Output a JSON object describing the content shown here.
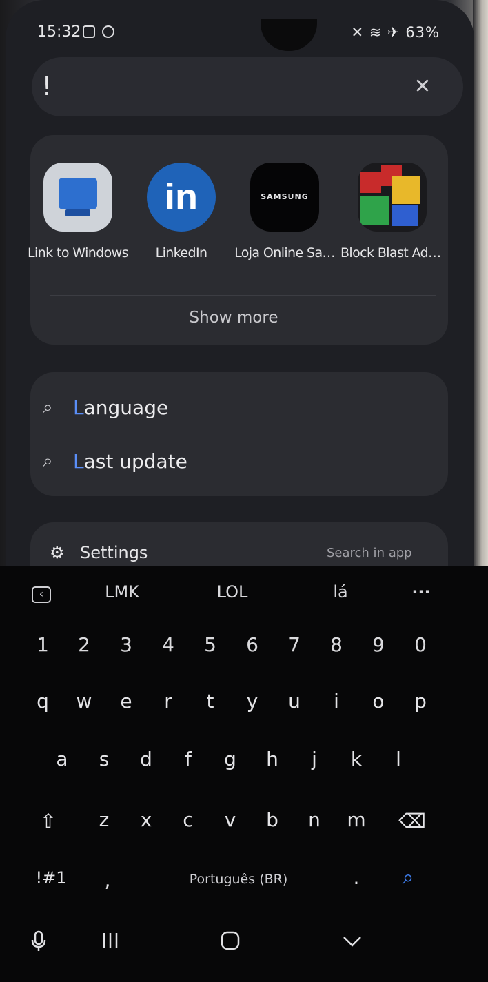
{
  "status_bar": {
    "time": "15:32",
    "right_icons": "✕ ≋ ✈ 63%"
  },
  "search": {
    "query": "!",
    "clear_icon": "✕"
  },
  "apps": [
    {
      "label": "Link to Windows",
      "icon": "link-to-windows-icon"
    },
    {
      "label": "LinkedIn",
      "icon": "linkedin-icon"
    },
    {
      "label": "Loja Online Sa…",
      "icon": "samsung-store-icon"
    },
    {
      "label": "Block Blast Adv…",
      "icon": "block-blast-icon"
    }
  ],
  "samsung_logo_text": "SAMSUNG",
  "show_more": "Show more",
  "suggestions": [
    {
      "prefix": "L",
      "rest": "anguage"
    },
    {
      "prefix": "L",
      "rest": "ast update"
    }
  ],
  "settings": {
    "label": "Settings",
    "search_in_app": "Search in app"
  },
  "keyboard": {
    "toolbar": [
      "LMK",
      "LOL",
      "lá",
      "···"
    ],
    "numbers": [
      "1",
      "2",
      "3",
      "4",
      "5",
      "6",
      "7",
      "8",
      "9",
      "0"
    ],
    "row1": [
      "q",
      "w",
      "e",
      "r",
      "t",
      "y",
      "u",
      "i",
      "o",
      "p"
    ],
    "row2": [
      "a",
      "s",
      "d",
      "f",
      "g",
      "h",
      "j",
      "k",
      "l"
    ],
    "row3": [
      "z",
      "x",
      "c",
      "v",
      "b",
      "n",
      "m"
    ],
    "symbols": "!#1",
    "comma": ",",
    "space": "Português (BR)",
    "period": "."
  },
  "colors": {
    "accent": "#5a8ef7",
    "search_key": "#3d7be8"
  }
}
